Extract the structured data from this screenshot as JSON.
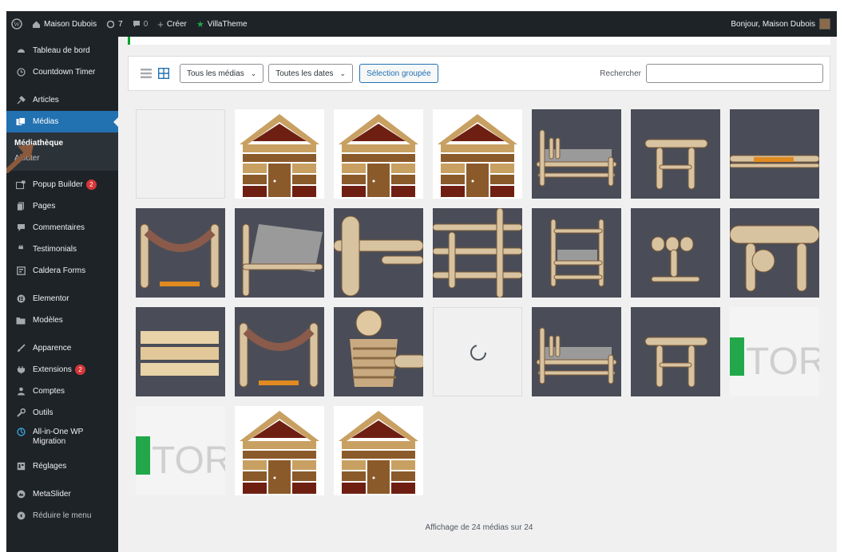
{
  "admin_bar": {
    "site_name": "Maison Dubois",
    "updates_count": "7",
    "comments_count": "0",
    "new_label": "Créer",
    "plugin_label": "VillaTheme",
    "greeting": "Bonjour, Maison Dubois"
  },
  "sidebar": {
    "items": [
      {
        "label": "Tableau de bord",
        "icon": "dashboard-icon"
      },
      {
        "label": "Countdown Timer",
        "icon": "clock-icon"
      },
      {
        "label": "Articles",
        "icon": "pin-icon"
      },
      {
        "label": "Médias",
        "icon": "media-icon",
        "active": true
      },
      {
        "label": "Popup Builder",
        "icon": "popup-icon",
        "badge": "2"
      },
      {
        "label": "Pages",
        "icon": "pages-icon"
      },
      {
        "label": "Commentaires",
        "icon": "comment-icon"
      },
      {
        "label": "Testimonials",
        "icon": "quote-icon"
      },
      {
        "label": "Caldera Forms",
        "icon": "forms-icon"
      },
      {
        "label": "Elementor",
        "icon": "elementor-icon"
      },
      {
        "label": "Modèles",
        "icon": "folder-icon"
      },
      {
        "label": "Apparence",
        "icon": "brush-icon"
      },
      {
        "label": "Extensions",
        "icon": "plugin-icon",
        "badge": "2"
      },
      {
        "label": "Comptes",
        "icon": "user-icon"
      },
      {
        "label": "Outils",
        "icon": "wrench-icon"
      },
      {
        "label": "All-in-One WP Migration",
        "icon": "migration-icon"
      },
      {
        "label": "Réglages",
        "icon": "settings-icon"
      },
      {
        "label": "MetaSlider",
        "icon": "slider-icon"
      },
      {
        "label": "Réduire le menu",
        "icon": "collapse-icon"
      }
    ],
    "submenu": {
      "library": "Médiathèque",
      "add": "Ajouter"
    }
  },
  "toolbar": {
    "filter_type": "Tous les médias",
    "filter_date": "Toutes les dates",
    "bulk_select": "Sélection groupée",
    "search_label": "Rechercher",
    "search_value": ""
  },
  "media_grid": {
    "items": [
      "blank",
      "logo-house",
      "logo-house",
      "logo-house",
      "bed-photo",
      "table-photo",
      "bench-detail-photo",
      "hammock-photo",
      "bed-detail-photo",
      "log-detail-photo",
      "frame-detail-photo",
      "chair-photo",
      "stool-photo",
      "table-detail-photo",
      "crate-photo",
      "hammock-photo",
      "rope-detail-photo",
      "loading",
      "bed-photo",
      "table-photo",
      "store-logo",
      "store-logo",
      "logo-house",
      "logo-house"
    ]
  },
  "footer": {
    "count_text": "Affichage de 24 médias sur 24"
  },
  "colors": {
    "admin_dark": "#1d2327",
    "accent": "#2271b1",
    "badge": "#d63638",
    "logo_brown": "#8b5a2b",
    "logo_tan": "#c8a062",
    "logo_dark_red": "#6e1f12",
    "store_green": "#22a84a"
  }
}
